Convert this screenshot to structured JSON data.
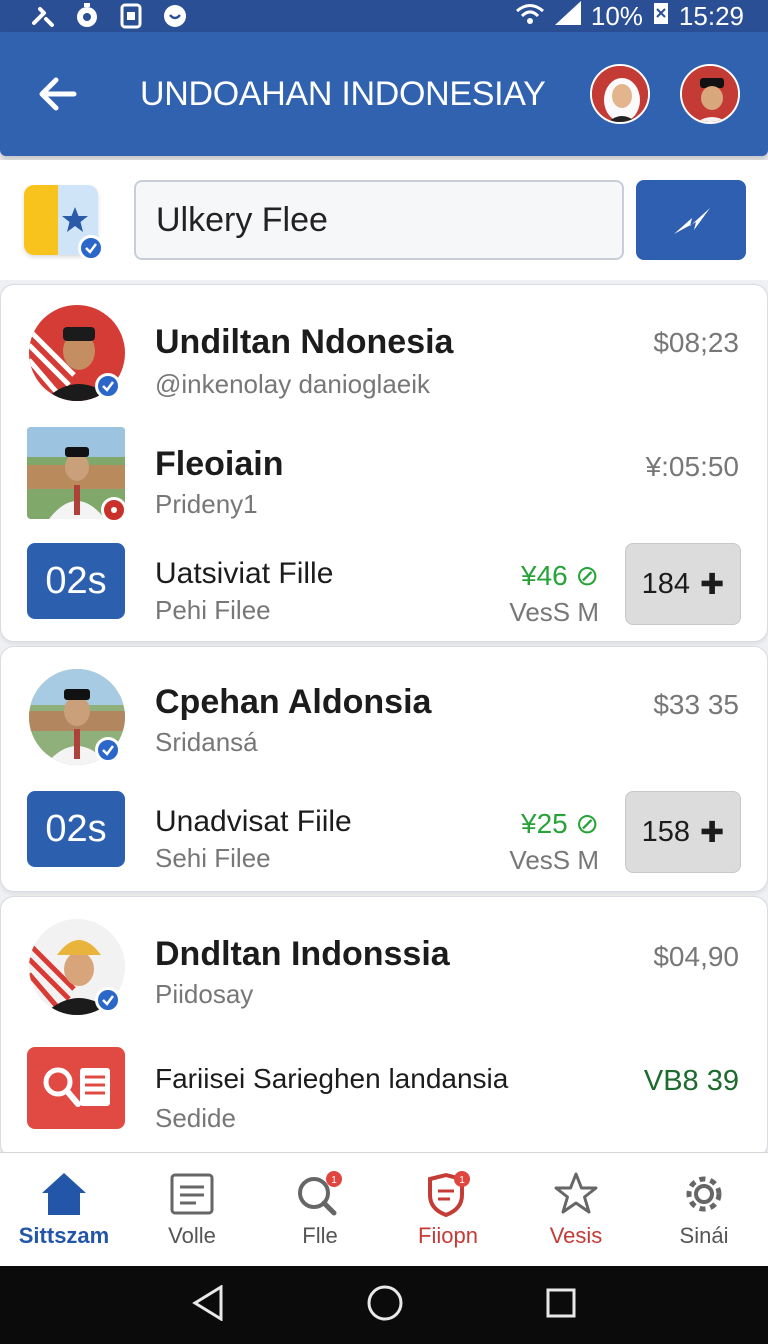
{
  "status_bar": {
    "battery": "10%",
    "time": "15:29"
  },
  "app_bar": {
    "title": "UNDOAHAN INDONESIAY"
  },
  "search": {
    "value": "Ulkery Flee"
  },
  "cards": [
    {
      "contacts": [
        {
          "name": "Undiltan Ndonesia",
          "handle": "@inkenolay danioglaeik",
          "amount": "$08;23"
        },
        {
          "name": "Fleoiain",
          "handle": "Pridenу1",
          "amount": "¥:05:50"
        }
      ],
      "file": {
        "tag": "02s",
        "name": "Uatsiviat Fille",
        "sub": "Pehi Filee",
        "price": "¥46",
        "status": "VesS M",
        "qty": "184"
      }
    },
    {
      "contacts": [
        {
          "name": "Cpehan Aldonsia",
          "handle": "Sridansá",
          "amount": "$33 35"
        }
      ],
      "file": {
        "tag": "02s",
        "name": "Unadvisat Fiile",
        "sub": "Sehi Filee",
        "price": "¥25",
        "status": "VesS M",
        "qty": "158"
      }
    },
    {
      "contacts": [
        {
          "name": "Dndltan Indonssia",
          "handle": "Piidosay",
          "amount": "$04,90"
        }
      ],
      "file": {
        "name": "Fariisei Sarieghen landansia",
        "sub": "Sedide",
        "price": "VB8 39"
      }
    }
  ],
  "bottom_nav": [
    {
      "label": "Sittszam",
      "icon": "home-icon"
    },
    {
      "label": "Volle",
      "icon": "document-icon"
    },
    {
      "label": "Flle",
      "icon": "search-icon",
      "badge": "1"
    },
    {
      "label": "Fiiopn",
      "icon": "shield-icon",
      "badge": "1"
    },
    {
      "label": "Vesis",
      "icon": "star-icon"
    },
    {
      "label": "Sinái",
      "icon": "gear-icon"
    }
  ],
  "colors": {
    "primary": "#3162b0",
    "accent_red": "#c53b36",
    "price_green": "#27a33a"
  }
}
